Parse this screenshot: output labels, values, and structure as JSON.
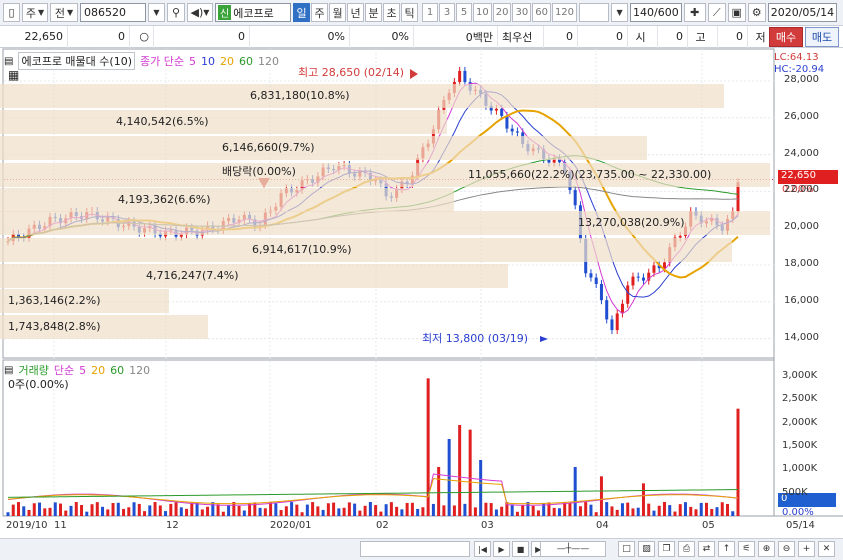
{
  "toolbar": {
    "mode": "주",
    "mode2": "전",
    "code": "086520",
    "credit_badge": "신",
    "stock_name": "에코프로",
    "periods": [
      "일",
      "주",
      "월",
      "년",
      "분",
      "초",
      "틱"
    ],
    "active_period": "일",
    "numbers": [
      "1",
      "3",
      "5",
      "10",
      "20",
      "30",
      "60",
      "120"
    ],
    "count": "140",
    "total": "/600",
    "date": "2020/05/14"
  },
  "quote": {
    "price": "22,650",
    "v1": "0",
    "v2": "0",
    "pct1": "0%",
    "pct2": "0%",
    "amount_label": "0백만",
    "best_label": "최우선",
    "bq1": "0",
    "bq2": "0",
    "open_label": "시",
    "open": "0",
    "high_label": "고",
    "high": "0",
    "low_label": "저",
    "low": "0",
    "buy": "매수",
    "sell": "매도"
  },
  "price_legend": {
    "title": "에코프로 매물대 수(10)",
    "ma_label": "종가 단순",
    "ma": [
      "5",
      "10",
      "20",
      "60",
      "120"
    ],
    "ma_colors": [
      "#d23bd2",
      "#2b3fd0",
      "#e6a300",
      "#2a9a2a",
      "#888888"
    ]
  },
  "volume_legend": {
    "title": "거래량",
    "ma_label": "단순",
    "ma": [
      "5",
      "20",
      "60",
      "120"
    ],
    "info": "0주(0.00%)"
  },
  "price_annotations": {
    "max_label": "최고 28,650 (02/14)",
    "min_label": "최저 13,800 (03/19)",
    "dividend": "배당락(0.00%)",
    "lc": "LC:64.13",
    "hc": "HC:-20.94",
    "current": "22,650",
    "current_pct": "0.00%",
    "vol_current": "0",
    "vol_pct": "0.00%"
  },
  "profile_bars": [
    {
      "label": "6,831,180(10.8%)",
      "fraction": 0.94
    },
    {
      "label": "4,140,542(6.5%)",
      "fraction": 0.58
    },
    {
      "label": "6,146,660(9.7%)",
      "fraction": 0.84
    },
    {
      "label": "11,055,660(22.2%)(23,735.00 ~ 22,330.00)",
      "fraction": 1.0
    },
    {
      "label": "4,193,362(6.6%)",
      "fraction": 0.59
    },
    {
      "label": "13,270,038(20.9%)",
      "fraction": 1.0
    },
    {
      "label": "6,914,617(10.9%)",
      "fraction": 0.95
    },
    {
      "label": "4,716,247(7.4%)",
      "fraction": 0.66
    },
    {
      "label": "1,363,146(2.2%)",
      "fraction": 0.22
    },
    {
      "label": "1,743,848(2.8%)",
      "fraction": 0.27
    }
  ],
  "price_axis": [
    "28,000",
    "26,000",
    "24,000",
    "22,000",
    "20,000",
    "18,000",
    "16,000",
    "14,000"
  ],
  "volume_axis": [
    "3,000K",
    "2,500K",
    "2,000K",
    "1,500K",
    "1,000K",
    "500K"
  ],
  "x_axis": [
    "2019/10",
    "11",
    "12",
    "2020/01",
    "02",
    "03",
    "04",
    "05",
    "05/14"
  ]
}
